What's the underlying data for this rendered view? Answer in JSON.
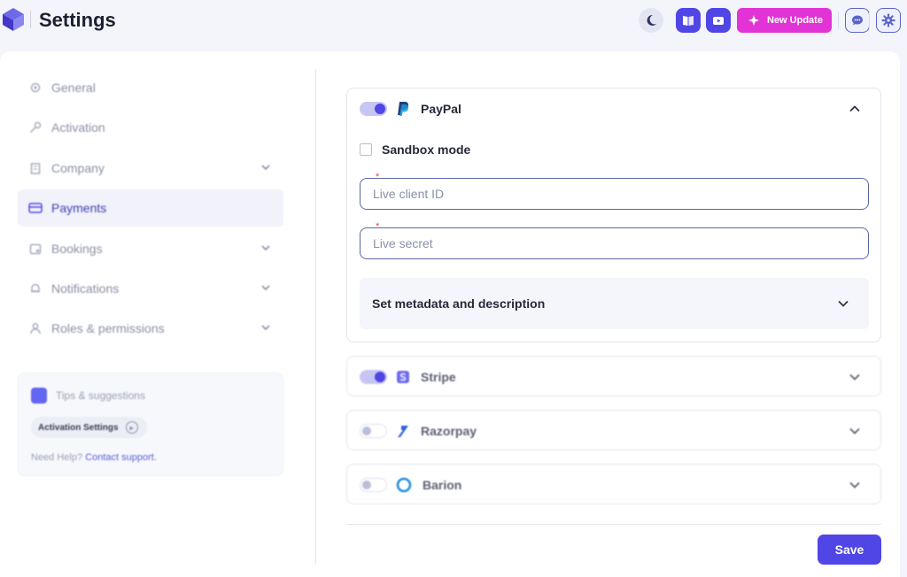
{
  "header": {
    "title": "Settings",
    "update_label": "New Update",
    "icons": [
      "logo-icon",
      "moon-icon",
      "book-icon",
      "youtube-icon",
      "sparkle-icon",
      "chat-icon",
      "gear-icon"
    ]
  },
  "colors": {
    "primary": "#4f46e5",
    "update_button": "#e233d6",
    "page_bg": "#f4f5fb",
    "required": "#e5484d"
  },
  "sidebar": {
    "items": [
      {
        "label": "General",
        "icon": "gear-icon",
        "active": false,
        "expandable": false
      },
      {
        "label": "Activation",
        "icon": "key-icon",
        "active": false,
        "expandable": false
      },
      {
        "label": "Company",
        "icon": "building-icon",
        "active": false,
        "expandable": true
      },
      {
        "label": "Payments",
        "icon": "card-icon",
        "active": true,
        "expandable": false
      },
      {
        "label": "Bookings",
        "icon": "calendar-icon",
        "active": false,
        "expandable": true
      },
      {
        "label": "Notifications",
        "icon": "bell-icon",
        "active": false,
        "expandable": true
      },
      {
        "label": "Roles & permissions",
        "icon": "user-icon",
        "active": false,
        "expandable": true
      }
    ]
  },
  "tips": {
    "title": "Tips & suggestions",
    "chip": "Activation Settings",
    "help_prefix": "Need Help?",
    "help_link": "Contact support."
  },
  "payments": {
    "paypal": {
      "name": "PayPal",
      "enabled": true,
      "expanded": true,
      "sandbox_label": "Sandbox mode",
      "sandbox_checked": false,
      "required_mark": "*",
      "client_id_placeholder": "Live client ID",
      "client_id_value": "",
      "secret_placeholder": "Live secret",
      "secret_value": "",
      "metadata_label": "Set metadata and description"
    },
    "stripe": {
      "name": "Stripe",
      "enabled": true
    },
    "razorpay": {
      "name": "Razorpay",
      "enabled": false
    },
    "barion": {
      "name": "Barion",
      "enabled": false
    }
  },
  "save_label": "Save"
}
